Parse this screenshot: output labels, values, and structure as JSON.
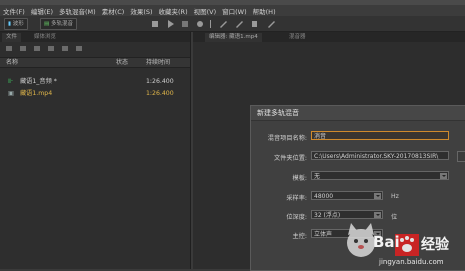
{
  "menu": [
    "文件(F)",
    "编辑(E)",
    "多轨混音(M)",
    "素材(C)",
    "效果(S)",
    "收藏夹(R)",
    "视图(V)",
    "窗口(W)",
    "帮助(H)"
  ],
  "toolbar": {
    "waveform_label": "波形",
    "multitrack_label": "多轨混音"
  },
  "left_panel": {
    "tab_files": "文件",
    "tab_media": "媒体浏览",
    "columns": {
      "name": "名称",
      "status": "状态",
      "duration": "持续时间"
    },
    "files": [
      {
        "name": "藏语1_音频 *",
        "duration": "1:26.400",
        "icon": "multitrack-icon",
        "color": "#cfcfcf"
      },
      {
        "name": "藏语1.mp4",
        "duration": "1:26.400",
        "icon": "video-file-icon",
        "color": "#e0b64a"
      }
    ]
  },
  "right_panel": {
    "tab_editor": "编辑器: 藏语1.mp4",
    "tab_mixer": "混音器"
  },
  "dialog": {
    "title": "新建多轨混音",
    "session_name_label": "混音项目名称:",
    "session_name_value": "消音",
    "folder_label": "文件夹位置:",
    "folder_value": "C:\\Users\\Administrator.SKY-20170813SIR\\",
    "template_label": "模板:",
    "template_value": "无",
    "sample_rate_label": "采样率:",
    "sample_rate_value": "48000",
    "sample_rate_unit": "Hz",
    "bit_depth_label": "位深度:",
    "bit_depth_value": "32 (浮点)",
    "bit_depth_unit": "位",
    "master_label": "主控:",
    "master_value": "立体声"
  },
  "watermark": {
    "brand": "Bai",
    "suffix": "经验",
    "url": "jingyan.baidu.com"
  },
  "colors": {
    "accent_orange": "#d08a2c",
    "file_highlight": "#e0b64a",
    "multitrack_icon": "#3fbf5f"
  }
}
